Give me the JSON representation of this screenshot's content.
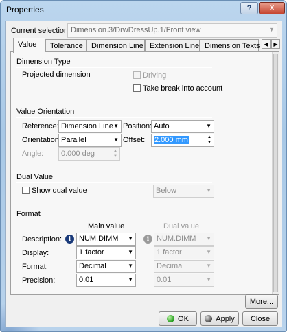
{
  "window": {
    "title": "Properties",
    "help_glyph": "?",
    "close_glyph": "X"
  },
  "current_selection": {
    "label": "Current selection :",
    "value": "Dimension.3/DrwDressUp.1/Front view"
  },
  "tabs": [
    "Value",
    "Tolerance",
    "Dimension Line",
    "Extension Line",
    "Dimension Texts"
  ],
  "active_tab": "Value",
  "dimension_type": {
    "heading": "Dimension Type",
    "projected_label": "Projected dimension",
    "driving_label": "Driving",
    "take_break_label": "Take break into account"
  },
  "value_orientation": {
    "heading": "Value Orientation",
    "reference_label": "Reference:",
    "reference_value": "Dimension Line",
    "position_label": "Position:",
    "position_value": "Auto",
    "orientation_label": "Orientation:",
    "orientation_value": "Parallel",
    "offset_label": "Offset:",
    "offset_value": "2.000 mm",
    "angle_label": "Angle:",
    "angle_value": "0.000 deg"
  },
  "dual_value": {
    "heading": "Dual Value",
    "show_label": "Show dual value",
    "position_value": "Below"
  },
  "format": {
    "heading": "Format",
    "main_header": "Main value",
    "dual_header": "Dual value",
    "rows": [
      {
        "label": "Description:",
        "main": "NUM.DIMM",
        "dual": "NUM.DIMM"
      },
      {
        "label": "Display:",
        "main": "1 factor",
        "dual": "1 factor"
      },
      {
        "label": "Format:",
        "main": "Decimal",
        "dual": "Decimal"
      },
      {
        "label": "Precision:",
        "main": "0.01",
        "dual": "0.01"
      }
    ]
  },
  "buttons": {
    "more": "More...",
    "ok": "OK",
    "apply": "Apply",
    "close": "Close"
  },
  "icons": {
    "dropdown": "▼",
    "spin_up": "▲",
    "spin_down": "▼",
    "tab_left": "◀",
    "tab_right": "▶",
    "info": "i"
  },
  "colors": {
    "accent_selection": "#3399ff",
    "ok_indicator": "#1f9a1a"
  }
}
